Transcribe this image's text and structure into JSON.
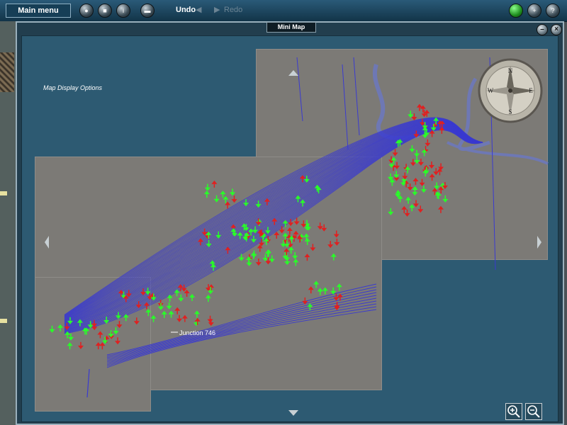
{
  "toolbar": {
    "main_menu_label": "Main menu",
    "undo_label": "Undo",
    "redo_label": "Redo"
  },
  "window": {
    "title": "Mini Map",
    "minimize_glyph": "–",
    "close_glyph": "×"
  },
  "map": {
    "display_options_label": "Map Display Options",
    "junction_label": "Junction 746",
    "compass": {
      "north": "N",
      "south": "S",
      "east": "E",
      "west": "W"
    }
  },
  "icons": {
    "toolbar": [
      "globe-icon",
      "stop-icon",
      "info-icon",
      "trash-icon",
      "green-status-icon",
      "add-icon",
      "help-icon"
    ],
    "zoom": [
      "zoom-in-icon",
      "zoom-out-icon"
    ]
  },
  "colors": {
    "track": "#3a3ad0",
    "signal_green": "#28ff28",
    "signal_red": "#e02020",
    "water": "#6e78b4",
    "tile": "#7c7a76",
    "frame": "#2d5a72"
  }
}
